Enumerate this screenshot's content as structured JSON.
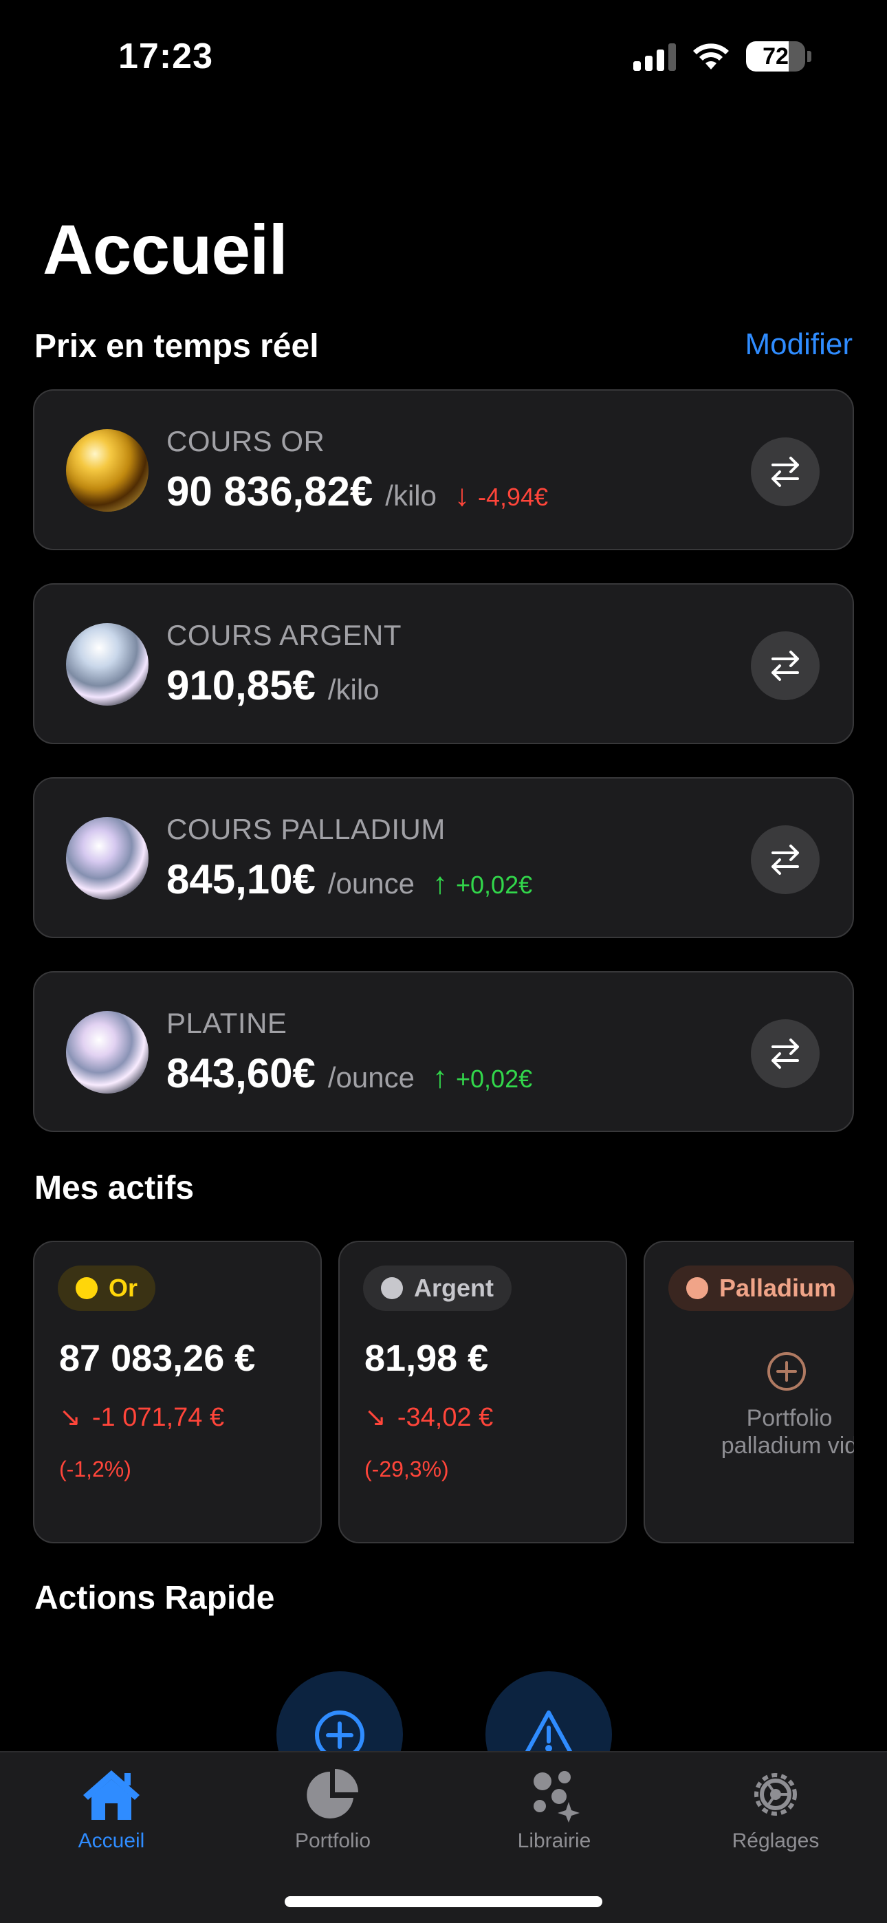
{
  "status_bar": {
    "time": "17:23",
    "battery_level": "72",
    "battery_fraction": 0.72
  },
  "header": {
    "title": "Accueil"
  },
  "prices_section": {
    "title": "Prix en temps réel",
    "modify_label": "Modifier"
  },
  "prices": [
    {
      "label": "COURS OR",
      "price": "90 836,82€",
      "unit": "/kilo",
      "change": "-4,94€",
      "direction": "down",
      "icon": "gold-nugget-icon"
    },
    {
      "label": "COURS ARGENT",
      "price": "910,85€",
      "unit": "/kilo",
      "change": "",
      "direction": "none",
      "icon": "silver-sphere-icon"
    },
    {
      "label": "COURS PALLADIUM",
      "price": "845,10€",
      "unit": "/ounce",
      "change": "+0,02€",
      "direction": "up",
      "icon": "palladium-sphere-icon"
    },
    {
      "label": "PLATINE",
      "price": "843,60€",
      "unit": "/ounce",
      "change": "+0,02€",
      "direction": "up",
      "icon": "platinum-sphere-icon"
    }
  ],
  "assets_section": {
    "title": "Mes actifs"
  },
  "assets": [
    {
      "name": "Or",
      "value": "87 083,26 €",
      "change": "-1 071,74 €",
      "percent": "(-1,2%)",
      "color": "#ffd60a"
    },
    {
      "name": "Argent",
      "value": "81,98 €",
      "change": "-34,02 €",
      "percent": "(-29,3%)",
      "color": "#c7c7cc"
    },
    {
      "name": "Palladium",
      "empty_text_line1": "Portfolio",
      "empty_text_line2": "palladium vid",
      "color": "#f0a488"
    }
  ],
  "actions_section": {
    "title": "Actions Rapide"
  },
  "quick_actions": [
    {
      "icon": "plus-circle-icon"
    },
    {
      "icon": "warning-triangle-icon"
    }
  ],
  "tabs": [
    {
      "label": "Accueil",
      "icon": "house-icon",
      "active": true
    },
    {
      "label": "Portfolio",
      "icon": "pie-chart-icon",
      "active": false
    },
    {
      "label": "Librairie",
      "icon": "sparkles-icon",
      "active": false
    },
    {
      "label": "Réglages",
      "icon": "gear-icon",
      "active": false
    }
  ],
  "colors": {
    "accent": "#2f8cff",
    "negative": "#ff453a",
    "positive": "#32d74b",
    "card": "#1c1c1e"
  }
}
